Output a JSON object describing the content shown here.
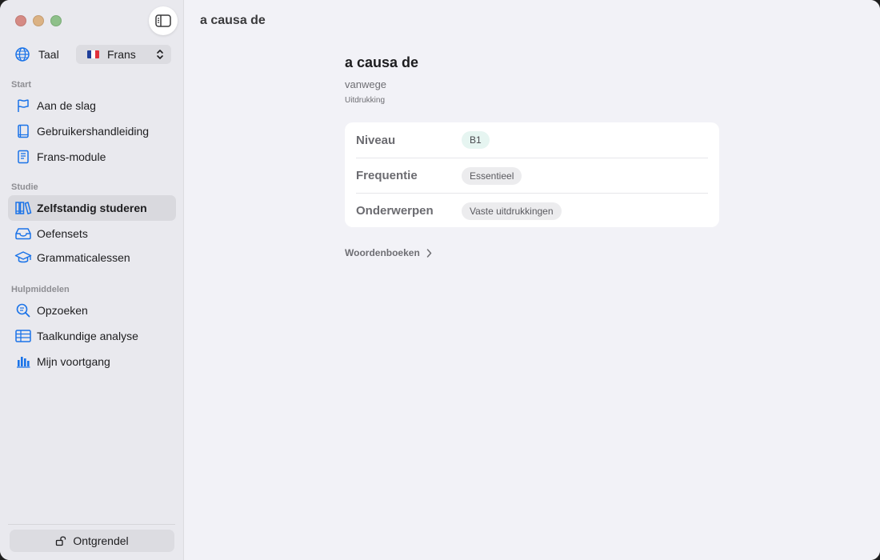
{
  "window": {
    "title": "a causa de"
  },
  "sidebar": {
    "language_label": "Taal",
    "language_value": "Frans",
    "sections": [
      {
        "label": "Start"
      },
      {
        "label": "Studie"
      },
      {
        "label": "Hulpmiddelen"
      }
    ],
    "items": [
      {
        "label": "Aan de slag",
        "icon": "flag-icon"
      },
      {
        "label": "Gebruikershandleiding",
        "icon": "book-icon"
      },
      {
        "label": "Frans-module",
        "icon": "module-book-icon"
      },
      {
        "label": "Zelfstandig studeren",
        "icon": "library-books-icon",
        "active": true
      },
      {
        "label": "Oefensets",
        "icon": "tray-icon"
      },
      {
        "label": "Grammaticalessen",
        "icon": "graduation-cap-icon"
      },
      {
        "label": "Opzoeken",
        "icon": "magnifier-text-icon"
      },
      {
        "label": "Taalkundige analyse",
        "icon": "table-icon"
      },
      {
        "label": "Mijn voortgang",
        "icon": "bar-chart-icon"
      }
    ],
    "unlock_label": "Ontgrendel"
  },
  "entry": {
    "word": "a causa de",
    "translation": "vanwege",
    "type": "Uitdrukking",
    "properties": [
      {
        "key": "Niveau",
        "value": "B1"
      },
      {
        "key": "Frequentie",
        "value": "Essentieel"
      },
      {
        "key": "Onderwerpen",
        "value": "Vaste uitdrukkingen"
      }
    ],
    "dictionaries_link": "Woordenboeken"
  },
  "colors": {
    "accent": "#1a73e8",
    "sidebar_bg": "#e9e9ee",
    "main_bg": "#f2f2f7",
    "level_pill_bg": "#e6f5f1"
  }
}
